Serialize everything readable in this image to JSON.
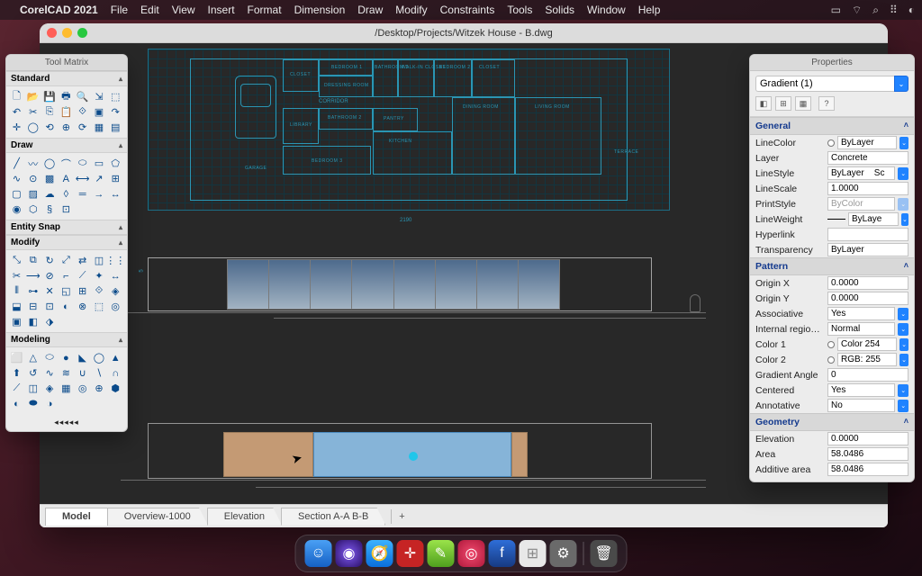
{
  "menubar": {
    "app": "CorelCAD 2021",
    "items": [
      "File",
      "Edit",
      "View",
      "Insert",
      "Format",
      "Dimension",
      "Draw",
      "Modify",
      "Constraints",
      "Tools",
      "Solids",
      "Window",
      "Help"
    ]
  },
  "window": {
    "title": "/Desktop/Projects/Witzek House - B.dwg"
  },
  "tabs": {
    "list": [
      "Model",
      "Overview-1000",
      "Elevation",
      "Section A-A B-B"
    ],
    "add": "+"
  },
  "floorplan": {
    "rooms": [
      "CLOSET",
      "BEDROOM 1",
      "BEDROOM 2",
      "DRESSING ROOM",
      "BATHROOM 1",
      "BATHROOM 2",
      "WALK-IN CLOSET",
      "LIBRARY",
      "PANTRY",
      "KITCHEN",
      "CORRIDOR",
      "DINING ROOM",
      "LIVING ROOM",
      "GARAGE",
      "BEDROOM 3",
      "TERRACE",
      "CLOSET"
    ],
    "dim_main": "2190",
    "elev_label": "5"
  },
  "toolmatrix": {
    "title": "Tool Matrix",
    "sections": {
      "standard": "Standard",
      "draw": "Draw",
      "esnap": "Entity Snap",
      "modify": "Modify",
      "modeling": "Modeling"
    },
    "footer": "◂◂◂◂◂"
  },
  "properties": {
    "title": "Properties",
    "selection": "Gradient (1)",
    "groups": {
      "general": {
        "label": "General",
        "rows": {
          "linecolor": {
            "label": "LineColor",
            "value": "ByLayer"
          },
          "layer": {
            "label": "Layer",
            "value": "Concrete"
          },
          "linestyle": {
            "label": "LineStyle",
            "value": "ByLayer    Sc"
          },
          "linescale": {
            "label": "LineScale",
            "value": "1.0000"
          },
          "printstyle": {
            "label": "PrintStyle",
            "value": "ByColor"
          },
          "lineweight": {
            "label": "LineWeight",
            "value": "ByLaye"
          },
          "hyperlink": {
            "label": "Hyperlink",
            "value": ""
          },
          "transparency": {
            "label": "Transparency",
            "value": "ByLayer"
          }
        }
      },
      "pattern": {
        "label": "Pattern",
        "rows": {
          "originx": {
            "label": "Origin X",
            "value": "0.0000"
          },
          "originy": {
            "label": "Origin Y",
            "value": "0.0000"
          },
          "associative": {
            "label": "Associative",
            "value": "Yes"
          },
          "internal": {
            "label": "Internal regio…",
            "value": "Normal"
          },
          "color1": {
            "label": "Color 1",
            "value": "Color 254"
          },
          "color2": {
            "label": "Color 2",
            "value": "RGB: 255"
          },
          "gangle": {
            "label": "Gradient Angle",
            "value": "0"
          },
          "centered": {
            "label": "Centered",
            "value": "Yes"
          },
          "annotative": {
            "label": "Annotative",
            "value": "No"
          }
        }
      },
      "geometry": {
        "label": "Geometry",
        "rows": {
          "elevation": {
            "label": "Elevation",
            "value": "0.0000"
          },
          "area": {
            "label": "Area",
            "value": "58.0486"
          },
          "addarea": {
            "label": "Additive area",
            "value": "58.0486"
          }
        }
      }
    }
  }
}
